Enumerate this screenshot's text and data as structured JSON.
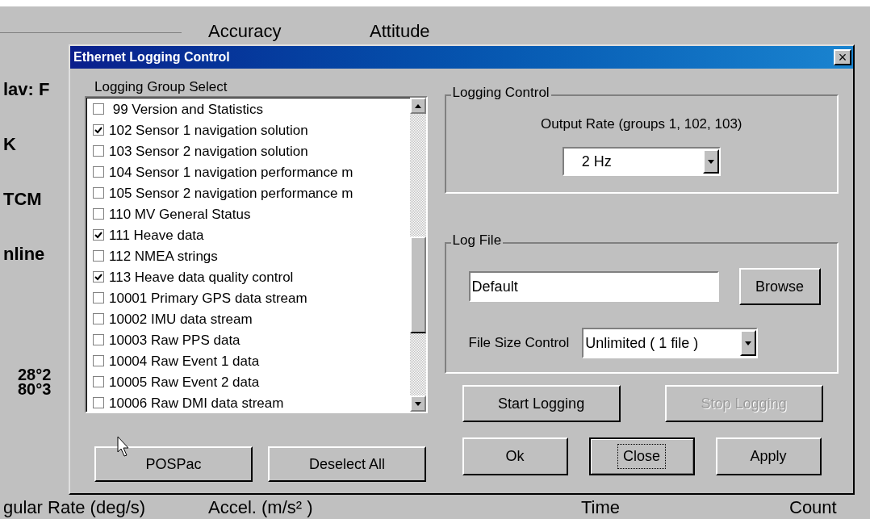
{
  "background": {
    "group_labels": [
      "Accuracy",
      "Attitude"
    ],
    "labels": [
      "lav: F",
      "K",
      "TCM",
      "nline",
      "28°2",
      "80°3"
    ],
    "footer": [
      "gular Rate (deg/s)",
      "Accel. (m/s² )",
      "Time",
      "Count"
    ]
  },
  "dialog": {
    "title": "Ethernet Logging Control",
    "close": "×",
    "group_select": {
      "label": "Logging Group Select",
      "items": [
        {
          "label": " 99 Version and Statistics",
          "checked": false
        },
        {
          "label": "102 Sensor 1 navigation solution",
          "checked": true
        },
        {
          "label": "103 Sensor 2 navigation solution",
          "checked": false
        },
        {
          "label": "104 Sensor 1 navigation performance m",
          "checked": false
        },
        {
          "label": "105 Sensor 2 navigation performance m",
          "checked": false
        },
        {
          "label": "110 MV General Status",
          "checked": false
        },
        {
          "label": "111 Heave data",
          "checked": true
        },
        {
          "label": "112 NMEA strings",
          "checked": false
        },
        {
          "label": "113 Heave data quality control",
          "checked": true
        },
        {
          "label": "10001 Primary GPS data stream",
          "checked": false
        },
        {
          "label": "10002 IMU data stream",
          "checked": false
        },
        {
          "label": "10003 Raw PPS data",
          "checked": false
        },
        {
          "label": "10004 Raw Event 1 data",
          "checked": false
        },
        {
          "label": "10005 Raw Event 2 data",
          "checked": false
        },
        {
          "label": "10006 Raw DMI data stream",
          "checked": false
        }
      ],
      "buttons": [
        {
          "label": "POSPac",
          "disabled": false,
          "focused": false
        },
        {
          "label": "Deselect All",
          "disabled": false,
          "focused": false
        }
      ]
    },
    "logging_control": {
      "label": "Logging Control",
      "output_rate_label": "Output Rate (groups 1, 102, 103)",
      "output_rate": "2 Hz"
    },
    "log_file": {
      "label": "Log File",
      "file_name": "Default",
      "browse": "Browse",
      "file_size_label": "File Size Control",
      "file_size": "Unlimited ( 1 file )"
    },
    "logging_buttons": [
      {
        "label": "Start Logging",
        "disabled": false,
        "focused": false
      },
      {
        "label": "Stop Logging",
        "disabled": true,
        "focused": false
      }
    ],
    "buttons": [
      {
        "label": "Ok",
        "disabled": false,
        "focused": false
      },
      {
        "label": "Close",
        "disabled": false,
        "focused": true
      },
      {
        "label": "Apply",
        "disabled": false,
        "focused": false
      }
    ]
  }
}
